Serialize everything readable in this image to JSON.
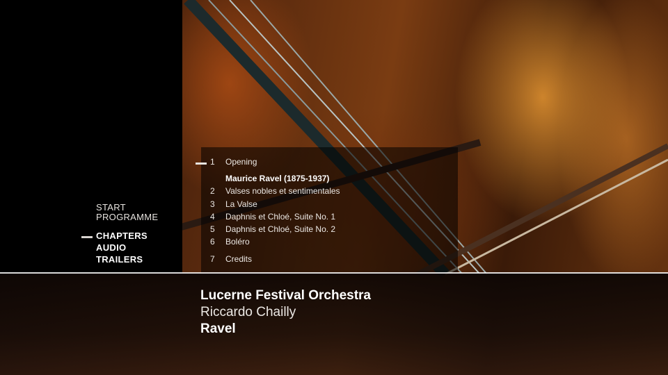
{
  "menu": {
    "items": [
      {
        "label": "START"
      },
      {
        "label": "PROGRAMME"
      },
      {
        "label": "CHAPTERS"
      },
      {
        "label": "AUDIO"
      },
      {
        "label": "TRAILERS"
      }
    ],
    "selected": "CHAPTERS"
  },
  "chapters": {
    "items": [
      {
        "num": "1",
        "label": "Opening"
      },
      {
        "num": "",
        "label": "Maurice Ravel (1875-1937)"
      },
      {
        "num": "2",
        "label": "Valses nobles et sentimentales"
      },
      {
        "num": "3",
        "label": "La Valse"
      },
      {
        "num": "4",
        "label": "Daphnis et Chloé, Suite No. 1"
      },
      {
        "num": "5",
        "label": "Daphnis et Chloé, Suite No. 2"
      },
      {
        "num": "6",
        "label": "Boléro"
      },
      {
        "num": "7",
        "label": "Credits"
      }
    ],
    "selected": "1"
  },
  "footer": {
    "orchestra": "Lucerne Festival Orchestra",
    "conductor": "Riccardo Chailly",
    "composer": "Ravel"
  }
}
